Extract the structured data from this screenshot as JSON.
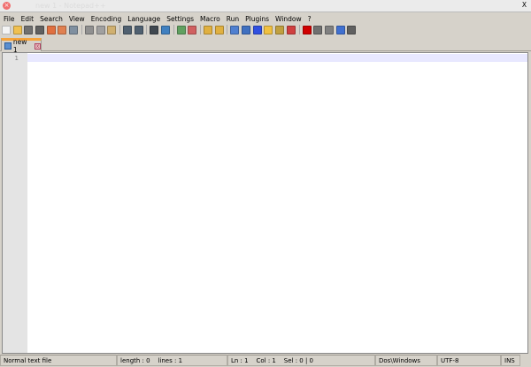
{
  "window": {
    "title": "new 1 - Notepad++",
    "close": "×"
  },
  "menu": [
    "File",
    "Edit",
    "Search",
    "View",
    "Encoding",
    "Language",
    "Settings",
    "Macro",
    "Run",
    "Plugins",
    "Window",
    "?"
  ],
  "menu_close": "X",
  "toolbar": [
    {
      "name": "new-file-icon",
      "color": "#f4f4f4"
    },
    {
      "name": "open-file-icon",
      "color": "#f0c050"
    },
    {
      "name": "save-icon",
      "color": "#707070"
    },
    {
      "name": "save-all-icon",
      "color": "#606060"
    },
    {
      "name": "close-icon",
      "color": "#e07040"
    },
    {
      "name": "close-all-icon",
      "color": "#e08050"
    },
    {
      "name": "print-icon",
      "color": "#8090a0"
    },
    "sep",
    {
      "name": "cut-icon",
      "color": "#909090"
    },
    {
      "name": "copy-icon",
      "color": "#a0a0a0"
    },
    {
      "name": "paste-icon",
      "color": "#d0b070"
    },
    "sep",
    {
      "name": "undo-icon",
      "color": "#506070"
    },
    {
      "name": "redo-icon",
      "color": "#506070"
    },
    "sep",
    {
      "name": "find-icon",
      "color": "#404850"
    },
    {
      "name": "replace-icon",
      "color": "#4080c0"
    },
    "sep",
    {
      "name": "zoom-in-icon",
      "color": "#60a060"
    },
    {
      "name": "zoom-out-icon",
      "color": "#d06060"
    },
    "sep",
    {
      "name": "sync-vertical-icon",
      "color": "#e0b040"
    },
    {
      "name": "sync-horizontal-icon",
      "color": "#e0b040"
    },
    "sep",
    {
      "name": "word-wrap-icon",
      "color": "#5080d0"
    },
    {
      "name": "show-all-chars-icon",
      "color": "#4070c0"
    },
    {
      "name": "indent-guide-icon",
      "color": "#3050e0"
    },
    {
      "name": "user-lang-icon",
      "color": "#f0c040"
    },
    {
      "name": "doc-map-icon",
      "color": "#c0a040"
    },
    {
      "name": "function-list-icon",
      "color": "#d04040"
    },
    "sep",
    {
      "name": "record-macro-icon",
      "color": "#d00000"
    },
    {
      "name": "stop-record-icon",
      "color": "#707070"
    },
    {
      "name": "play-macro-icon",
      "color": "#808080"
    },
    {
      "name": "run-macro-multiple-icon",
      "color": "#4070d0"
    },
    {
      "name": "save-macro-icon",
      "color": "#606060"
    }
  ],
  "tab": {
    "label": "new 1",
    "close": "x"
  },
  "editor": {
    "line_numbers": [
      "1"
    ]
  },
  "status": {
    "file_type": "Normal text file",
    "length": "length : 0    lines : 1",
    "position": "Ln : 1    Col : 1    Sel : 0 | 0",
    "eol": "Dos\\Windows",
    "encoding": "UTF-8",
    "mode": "INS"
  }
}
